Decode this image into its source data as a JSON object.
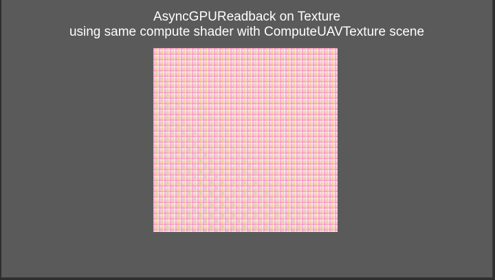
{
  "scene": {
    "title_line_1": "AsyncGPUReadback on Texture",
    "title_line_2": "using same compute shader with ComputeUAVTexture scene"
  },
  "colors": {
    "background": "#5a5a5a",
    "caption_text": "#ffffff",
    "texture_pink": "#f4c9d9"
  }
}
